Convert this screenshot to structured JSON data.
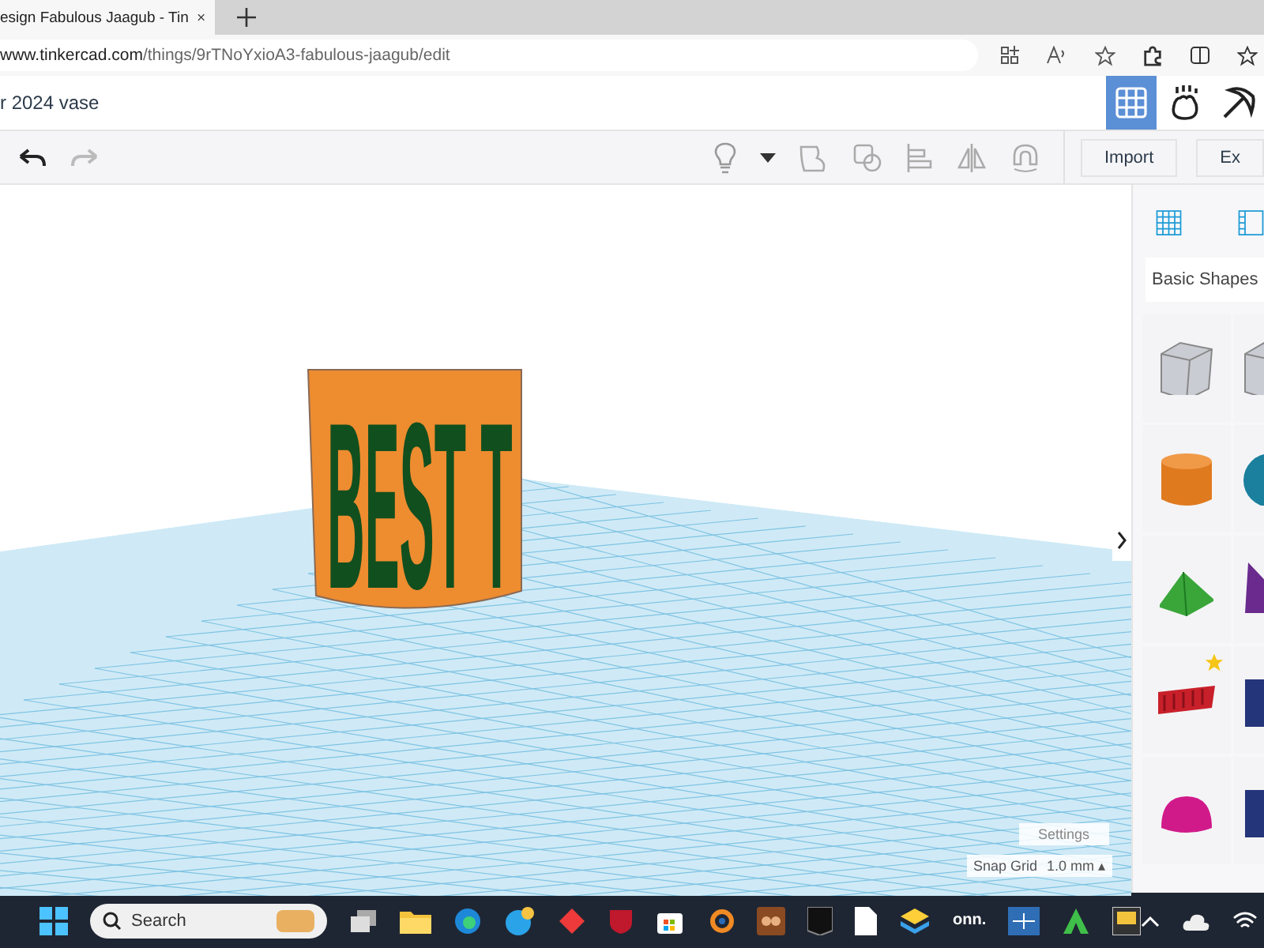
{
  "browser": {
    "tab_title": "esign Fabulous Jaagub - Tin",
    "url_host": "www.tinkercad.com",
    "url_path": "/things/9rTNoYxioA3-fabulous-jaagub/edit"
  },
  "app": {
    "design_title": "r 2024 vase",
    "views": [
      {
        "kind": "grid",
        "selected": true
      },
      {
        "kind": "hand",
        "selected": false
      },
      {
        "kind": "pickaxe",
        "selected": false
      }
    ]
  },
  "toolbar": {
    "import": "Import",
    "export": "Ex"
  },
  "panel": {
    "category": "Basic Shapes",
    "shapes": [
      {
        "kind": "box"
      },
      {
        "kind": "box"
      },
      {
        "kind": "cylinder"
      },
      {
        "kind": "sphere"
      },
      {
        "kind": "roof"
      },
      {
        "kind": "cone"
      },
      {
        "kind": "text",
        "starred": true
      },
      {
        "kind": "block"
      },
      {
        "kind": "halfsphere"
      },
      {
        "kind": "block"
      }
    ]
  },
  "model": {
    "text": "BEST T"
  },
  "canvas": {
    "settings": "Settings",
    "snap_label": "Snap Grid",
    "snap_value": "1.0 mm",
    "snap_arrow": "▴"
  },
  "taskbar": {
    "search": "Search",
    "onn": "onn."
  }
}
